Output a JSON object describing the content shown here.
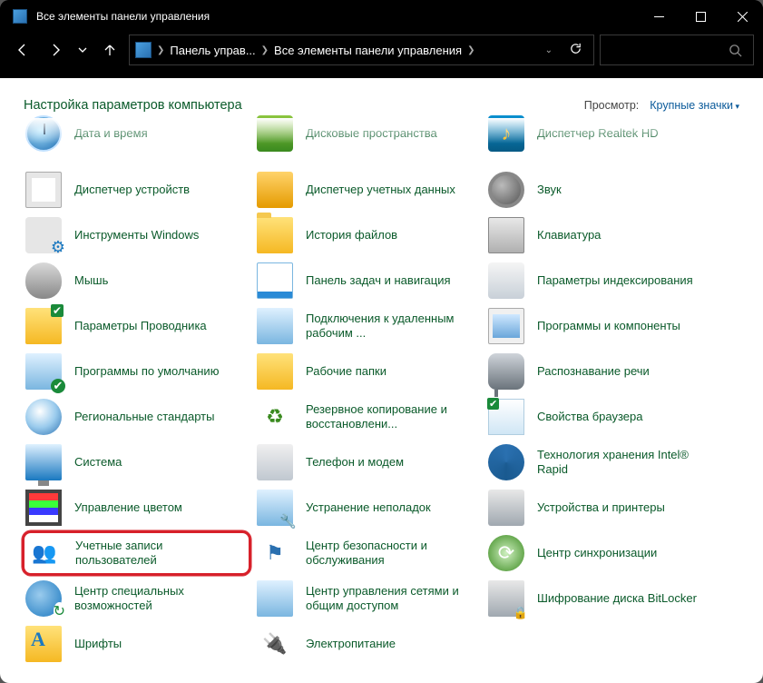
{
  "titlebar": {
    "title": "Все элементы панели управления"
  },
  "breadcrumb": {
    "c1": "Панель управ...",
    "c2": "Все элементы панели управления"
  },
  "header": {
    "title": "Настройка параметров компьютера",
    "viewlbl": "Просмотр:",
    "viewsel": "Крупные значки"
  },
  "items": [
    {
      "label": "Дата и время",
      "icon": "ic-clock",
      "cut": true
    },
    {
      "label": "Дисковые пространства",
      "icon": "ic-drive",
      "cut": true
    },
    {
      "label": "Диспетчер Realtek HD",
      "icon": "ic-realtek",
      "cut": true
    },
    {
      "label": "Диспетчер устройств",
      "icon": "ic-device"
    },
    {
      "label": "Диспетчер учетных данных",
      "icon": "ic-creds"
    },
    {
      "label": "Звук",
      "icon": "ic-sound"
    },
    {
      "label": "Инструменты Windows",
      "icon": "ic-tools"
    },
    {
      "label": "История файлов",
      "icon": "ic-folder"
    },
    {
      "label": "Клавиатура",
      "icon": "ic-keyboard"
    },
    {
      "label": "Мышь",
      "icon": "ic-mouse"
    },
    {
      "label": "Панель задач и навигация",
      "icon": "ic-taskbar"
    },
    {
      "label": "Параметры индексирования",
      "icon": "ic-index"
    },
    {
      "label": "Параметры Проводника",
      "icon": "ic-explorer"
    },
    {
      "label": "Подключения к удаленным рабочим ...",
      "icon": "ic-remote"
    },
    {
      "label": "Программы и компоненты",
      "icon": "ic-programs"
    },
    {
      "label": "Программы по умолчанию",
      "icon": "ic-default"
    },
    {
      "label": "Рабочие папки",
      "icon": "ic-work"
    },
    {
      "label": "Распознавание речи",
      "icon": "ic-speech"
    },
    {
      "label": "Региональные стандарты",
      "icon": "ic-region"
    },
    {
      "label": "Резервное копирование и восстановлени...",
      "icon": "ic-backup"
    },
    {
      "label": "Свойства браузера",
      "icon": "ic-browser"
    },
    {
      "label": "Система",
      "icon": "ic-system"
    },
    {
      "label": "Телефон и модем",
      "icon": "ic-phone"
    },
    {
      "label": "Технология хранения Intel® Rapid",
      "icon": "ic-intel"
    },
    {
      "label": "Управление цветом",
      "icon": "ic-color"
    },
    {
      "label": "Устранение неполадок",
      "icon": "ic-trouble"
    },
    {
      "label": "Устройства и принтеры",
      "icon": "ic-printer"
    },
    {
      "label": "Учетные записи пользователей",
      "icon": "ic-users",
      "highlight": true
    },
    {
      "label": "Центр безопасности и обслуживания",
      "icon": "ic-flag"
    },
    {
      "label": "Центр синхронизации",
      "icon": "ic-sync"
    },
    {
      "label": "Центр специальных возможностей",
      "icon": "ic-ease"
    },
    {
      "label": "Центр управления сетями и общим доступом",
      "icon": "ic-network"
    },
    {
      "label": "Шифрование диска BitLocker",
      "icon": "ic-bitlocker"
    },
    {
      "label": "Шрифты",
      "icon": "ic-fonts"
    },
    {
      "label": "Электропитание",
      "icon": "ic-power"
    }
  ]
}
